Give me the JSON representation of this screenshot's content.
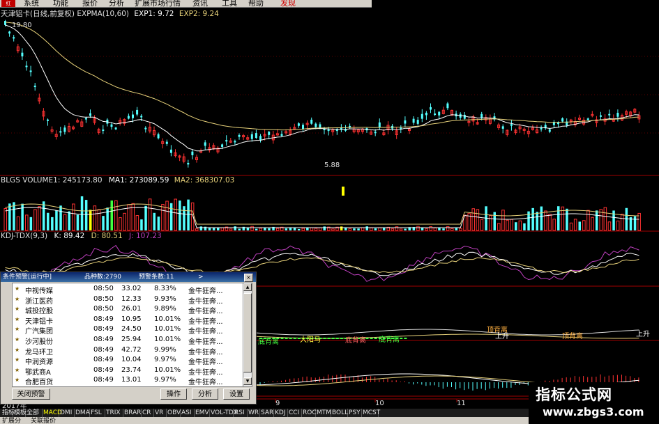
{
  "menubar": {
    "logo": "红",
    "items": [
      "系统",
      "功能",
      "报价",
      "分析",
      "扩展市场行情",
      "资讯",
      "工具",
      "帮助"
    ],
    "highlight": "发现"
  },
  "main_chart": {
    "title": "天津铝卡(日线,前复权) EXPMA(10,60)",
    "exp1": "EXP1: 9.72",
    "exp2": "EXP2: 9.24",
    "high_label": "19.80",
    "low_label": "5.88"
  },
  "volume": {
    "name": "BLGS VOLUME1: 245173.80",
    "ma1": "MA1: 273089.59",
    "ma2": "MA2: 368307.03"
  },
  "kdj": {
    "name": "KDJ-TDX(9,3)",
    "k": "K: 89.42",
    "d": "D: 80.51",
    "j": "J: 107.23"
  },
  "signal_panel": {
    "labels": [
      "大阳马",
      "底背离",
      "底背离",
      "顶背离",
      "上升",
      "顶背离",
      "上升",
      "底背离"
    ]
  },
  "left_labels": [
    "ZT",
    "MA"
  ],
  "date_axis": [
    "2017年",
    "9",
    "10",
    "11"
  ],
  "dialog": {
    "title_status": "条件预警[运行中]",
    "title_count": "品种数:2790",
    "title_alerts": "预警条数:11",
    "title_more": ">",
    "close": "×",
    "rows": [
      {
        "name": "中视传媒",
        "time": "08:50",
        "price": "33.02",
        "pct": "8.33%",
        "cond": "金牛狂奔..."
      },
      {
        "name": "浙江医药",
        "time": "08:50",
        "price": "12.33",
        "pct": "9.93%",
        "cond": "金牛狂奔..."
      },
      {
        "name": "城投控股",
        "time": "08:50",
        "price": "26.01",
        "pct": "9.89%",
        "cond": "金牛狂奔..."
      },
      {
        "name": "天津铝卡",
        "time": "08:49",
        "price": "10.95",
        "pct": "10.01%",
        "cond": "金牛狂奔..."
      },
      {
        "name": "广汽集团",
        "time": "08:49",
        "price": "24.50",
        "pct": "10.01%",
        "cond": "金牛狂奔..."
      },
      {
        "name": "沙河股份",
        "time": "08:49",
        "price": "25.94",
        "pct": "10.01%",
        "cond": "金牛狂奔..."
      },
      {
        "name": "龙马环卫",
        "time": "08:49",
        "price": "42.72",
        "pct": "9.99%",
        "cond": "金牛狂奔..."
      },
      {
        "name": "中润资源",
        "time": "08:49",
        "price": "10.04",
        "pct": "9.97%",
        "cond": "金牛狂奔..."
      },
      {
        "name": "鄂武商A",
        "time": "08:49",
        "price": "23.74",
        "pct": "10.01%",
        "cond": "金牛狂奔..."
      },
      {
        "name": "合肥百货",
        "time": "08:49",
        "price": "13.01",
        "pct": "9.97%",
        "cond": "金牛狂奔..."
      }
    ],
    "buttons": {
      "close_alert": "关闭预警",
      "operate": "操作",
      "analyze": "分析",
      "settings": "设置"
    }
  },
  "bottom_tabs": [
    "指标",
    "模板",
    "全部",
    "MACD",
    "DMI",
    "DMA",
    "FSL",
    "TRIX",
    "BRAR",
    "CR",
    "VR",
    "OBV",
    "ASI",
    "EMV",
    "VOL-TDX",
    "RSI",
    "WR",
    "SAR",
    "KDJ",
    "CCI",
    "ROC",
    "MTM",
    "BOLL",
    "PSY",
    "MCST"
  ],
  "extra_tabs": [
    "扩展分",
    "关联报价"
  ],
  "watermark": {
    "line1": "指标公式网",
    "line2": "www.zbgs3.com"
  },
  "colors": {
    "up": "#ff3232",
    "down": "#54ffff",
    "exp1": "#ffffff",
    "exp2": "#e8d27a",
    "kdj_j": "#c040c0",
    "highlight": "#ffff00"
  }
}
